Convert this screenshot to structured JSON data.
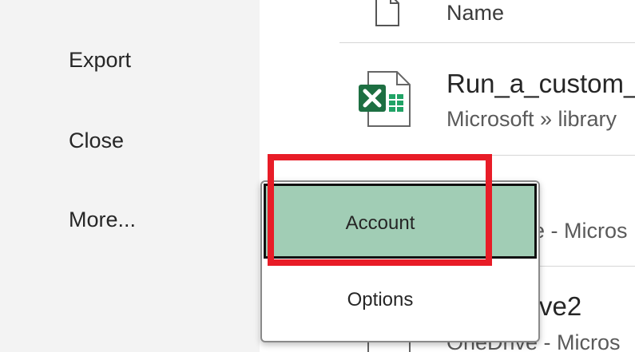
{
  "sidebar": {
    "items": [
      {
        "label": "Export"
      },
      {
        "label": "Close"
      },
      {
        "label": "More..."
      }
    ]
  },
  "file_list": {
    "column_header": "Name",
    "rows": [
      {
        "title": "Run_a_custom_",
        "subtitle": "Microsoft » library",
        "icon": "excel-file-icon"
      },
      {
        "title": "",
        "subtitle": "e - Micros",
        "icon": "file-icon"
      },
      {
        "title": "ve2",
        "subtitle": "OneDrive - Micros",
        "icon": "file-icon"
      }
    ]
  },
  "popup_menu": {
    "items": [
      {
        "label": "Account",
        "selected": true
      },
      {
        "label": "Options",
        "selected": false
      }
    ]
  },
  "colors": {
    "selected_bg": "#a1cdb5",
    "highlight": "#e81c27",
    "excel_green": "#1d6f42"
  }
}
